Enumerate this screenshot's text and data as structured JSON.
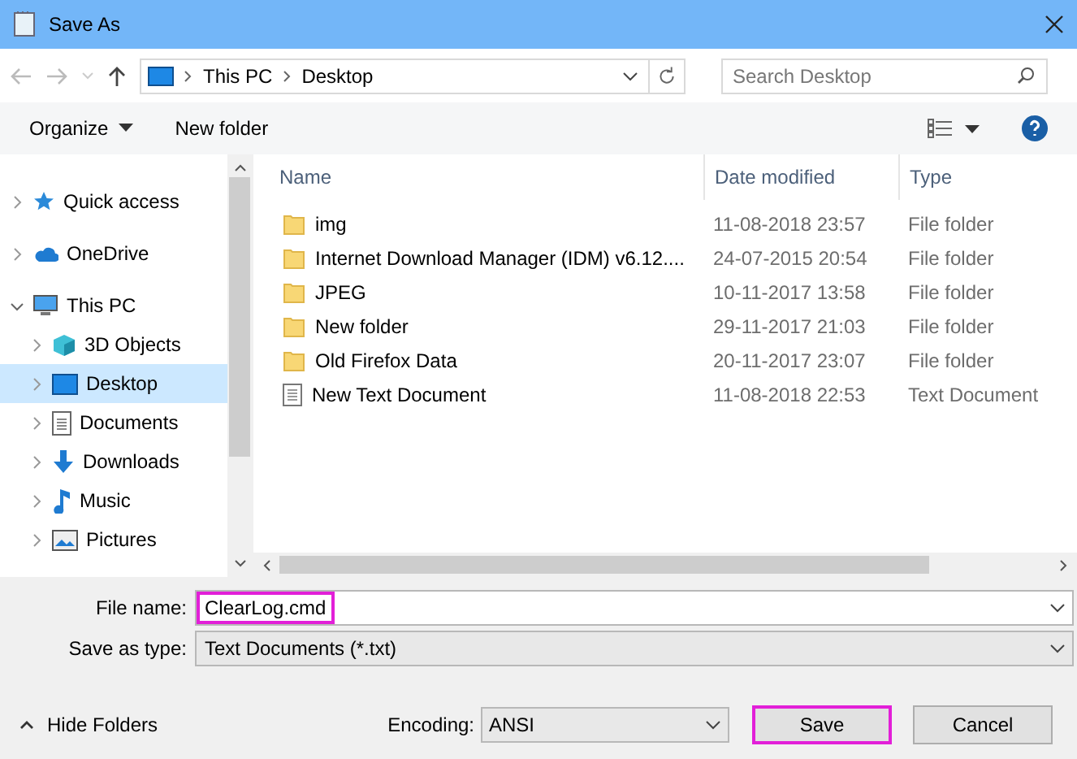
{
  "window": {
    "title": "Save As"
  },
  "address": {
    "path": [
      "This PC",
      "Desktop"
    ]
  },
  "search": {
    "placeholder": "Search Desktop"
  },
  "toolbar": {
    "organize": "Organize",
    "new_folder": "New folder"
  },
  "sidebar": {
    "items": [
      {
        "label": "Quick access",
        "kind": "star",
        "expanded": false,
        "selected": false
      },
      {
        "label": "OneDrive",
        "kind": "cloud",
        "expanded": false,
        "selected": false
      },
      {
        "label": "This PC",
        "kind": "pc",
        "expanded": true,
        "selected": false,
        "children": [
          {
            "label": "3D Objects",
            "kind": "cube",
            "expanded": false,
            "selected": false
          },
          {
            "label": "Desktop",
            "kind": "desktop",
            "expanded": false,
            "selected": true
          },
          {
            "label": "Documents",
            "kind": "doc",
            "expanded": false,
            "selected": false
          },
          {
            "label": "Downloads",
            "kind": "download",
            "expanded": false,
            "selected": false
          },
          {
            "label": "Music",
            "kind": "music",
            "expanded": false,
            "selected": false
          },
          {
            "label": "Pictures",
            "kind": "picture",
            "expanded": false,
            "selected": false
          }
        ]
      }
    ]
  },
  "table": {
    "columns": [
      "Name",
      "Date modified",
      "Type"
    ],
    "rows": [
      {
        "kind": "folder",
        "name": "img",
        "date": "11-08-2018 23:57",
        "type": "File folder"
      },
      {
        "kind": "folder",
        "name": "Internet Download Manager (IDM) v6.12....",
        "date": "24-07-2015 20:54",
        "type": "File folder"
      },
      {
        "kind": "folder",
        "name": "JPEG",
        "date": "10-11-2017 13:58",
        "type": "File folder"
      },
      {
        "kind": "folder",
        "name": "New folder",
        "date": "29-11-2017 21:03",
        "type": "File folder"
      },
      {
        "kind": "folder",
        "name": "Old Firefox Data",
        "date": "20-11-2017 23:07",
        "type": "File folder"
      },
      {
        "kind": "text",
        "name": "New Text Document",
        "date": "11-08-2018 22:53",
        "type": "Text Document"
      }
    ]
  },
  "form": {
    "file_name": {
      "label": "File name:",
      "value": "ClearLog.cmd",
      "highlighted": true
    },
    "save_as_type": {
      "label": "Save as type:",
      "value": "Text Documents (*.txt)"
    }
  },
  "footer": {
    "hide_folders": "Hide Folders",
    "encoding": {
      "label": "Encoding:",
      "value": "ANSI"
    },
    "buttons": [
      {
        "label": "Save",
        "highlighted": true
      },
      {
        "label": "Cancel",
        "highlighted": false
      }
    ]
  }
}
